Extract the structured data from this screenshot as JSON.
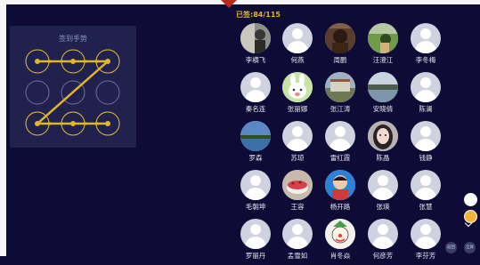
{
  "gesture": {
    "title": "签到手势"
  },
  "signin": {
    "count_label": "已签:84/115"
  },
  "participants": [
    {
      "name": "李横飞",
      "avatar": "photo-gray"
    },
    {
      "name": "何燕",
      "avatar": "placeholder"
    },
    {
      "name": "周鹏",
      "avatar": "photo-portrait-dark"
    },
    {
      "name": "汪澄江",
      "avatar": "photo-landscape-green"
    },
    {
      "name": "李冬梅",
      "avatar": "placeholder"
    },
    {
      "name": "秦名连",
      "avatar": "placeholder"
    },
    {
      "name": "张丽娜",
      "avatar": "cartoon-rabbit"
    },
    {
      "name": "张江涛",
      "avatar": "photo-building"
    },
    {
      "name": "安晓倩",
      "avatar": "photo-lake"
    },
    {
      "name": "陈澜",
      "avatar": "placeholder"
    },
    {
      "name": "罗森",
      "avatar": "photo-lake-blue"
    },
    {
      "name": "苏琼",
      "avatar": "placeholder"
    },
    {
      "name": "雷红霞",
      "avatar": "placeholder"
    },
    {
      "name": "陈晶",
      "avatar": "photo-girl"
    },
    {
      "name": "钱静",
      "avatar": "placeholder"
    },
    {
      "name": "毛朝坤",
      "avatar": "placeholder"
    },
    {
      "name": "王容",
      "avatar": "photo-cake"
    },
    {
      "name": "杨开路",
      "avatar": "photo-child"
    },
    {
      "name": "张瑛",
      "avatar": "placeholder"
    },
    {
      "name": "张慧",
      "avatar": "placeholder"
    },
    {
      "name": "罗丽丹",
      "avatar": "placeholder"
    },
    {
      "name": "孟雪如",
      "avatar": "placeholder"
    },
    {
      "name": "肖冬焱",
      "avatar": "cartoon-clown"
    },
    {
      "name": "何彦芳",
      "avatar": "placeholder"
    },
    {
      "name": "李芬芳",
      "avatar": "placeholder"
    }
  ],
  "dock": {
    "btn_left_label": "返回",
    "btn_right_label": "全屏"
  },
  "colors": {
    "background": "#0e0b37",
    "panel": "#20214d",
    "accent": "#e1b52a",
    "circle_stroke": "#6d6f9a"
  }
}
